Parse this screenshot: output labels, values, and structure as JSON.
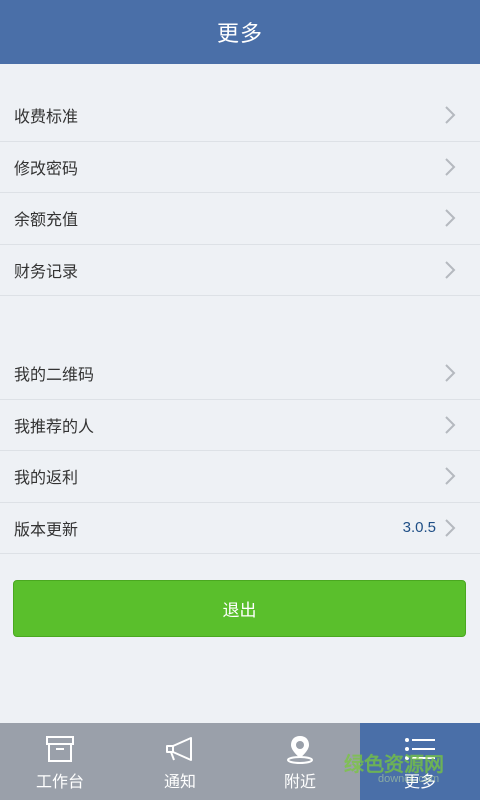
{
  "header": {
    "title": "更多"
  },
  "groups": [
    {
      "items": [
        {
          "label": "收费标准"
        },
        {
          "label": "修改密码"
        },
        {
          "label": "余额充值"
        },
        {
          "label": "财务记录"
        }
      ]
    },
    {
      "items": [
        {
          "label": "我的二维码"
        },
        {
          "label": "我推荐的人"
        },
        {
          "label": "我的返利"
        },
        {
          "label": "版本更新",
          "value": "3.0.5"
        }
      ]
    }
  ],
  "logout": {
    "label": "退出"
  },
  "tabbar": {
    "active_color": "#4a6fa8",
    "tabs": [
      {
        "label": "工作台",
        "icon": "archive-box-icon"
      },
      {
        "label": "通知",
        "icon": "megaphone-icon"
      },
      {
        "label": "附近",
        "icon": "location-pin-icon"
      },
      {
        "label": "更多",
        "icon": "menu-list-icon",
        "active": true
      }
    ]
  },
  "watermark": {
    "text": "绿色资源网",
    "sub": "downcc.com"
  }
}
